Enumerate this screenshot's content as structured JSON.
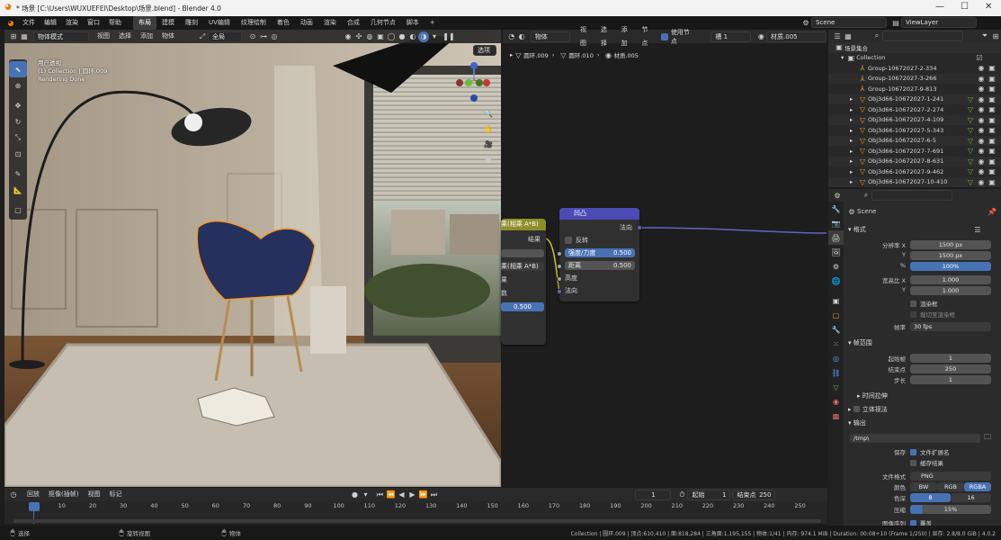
{
  "window": {
    "title": "* 场景 [C:\\Users\\WUXUEFEI\\Desktop\\场景.blend] - Blender 4.0"
  },
  "menus": [
    "文件",
    "编辑",
    "渲染",
    "窗口",
    "帮助"
  ],
  "workspaces": [
    {
      "label": "布局",
      "active": true
    },
    {
      "label": "建模"
    },
    {
      "label": "雕刻"
    },
    {
      "label": "UV编辑"
    },
    {
      "label": "纹理绘制"
    },
    {
      "label": "着色"
    },
    {
      "label": "动画"
    },
    {
      "label": "渲染"
    },
    {
      "label": "合成"
    },
    {
      "label": "几何节点"
    },
    {
      "label": "脚本"
    },
    {
      "label": "+"
    }
  ],
  "scene_selector": {
    "value": "Scene"
  },
  "viewlayer_selector": {
    "value": "ViewLayer"
  },
  "viewport": {
    "mode": "物体模式",
    "menus": [
      "视图",
      "选择",
      "添加",
      "物体"
    ],
    "orientation": "全局",
    "options_label": "选项",
    "overlay_lines": [
      "用户透视",
      "(1) Collection | 圆环.009",
      "Rendering Done"
    ]
  },
  "node_editor": {
    "type": "物体",
    "menus": [
      "视图",
      "选择",
      "添加",
      "节点"
    ],
    "use_nodes_label": "使用节点",
    "slot": "槽 1",
    "material": "材质.005",
    "breadcrumb": [
      "圆环.009",
      "圆环.010",
      "材质.005"
    ],
    "bump_node": {
      "title": "凹凸",
      "output": "法向",
      "invert": "反转",
      "strength_label": "强度/力度",
      "strength": "0.500",
      "distance_label": "距离",
      "distance": "0.500",
      "height": "高度",
      "normal": "法向"
    },
    "partial_node": {
      "title": "乘(相乘 A*B)",
      "output": "结果",
      "dropdown": "乘(相乘 A*B)",
      "label1": "果",
      "label2": "数",
      "value": "0.500"
    }
  },
  "outliner": {
    "search_placeholder": "",
    "root": "场景集合",
    "collection": "Collection",
    "items": [
      {
        "name": "Group-10672027-2-334",
        "kind": "group"
      },
      {
        "name": "Group-10672027-3-266",
        "kind": "group"
      },
      {
        "name": "Group-10672027-9-813",
        "kind": "group"
      },
      {
        "name": "Obj3d66-10672027-1-241",
        "kind": "mesh"
      },
      {
        "name": "Obj3d66-10672027-2-274",
        "kind": "mesh"
      },
      {
        "name": "Obj3d66-10672027-4-109",
        "kind": "mesh"
      },
      {
        "name": "Obj3d66-10672027-5-343",
        "kind": "mesh"
      },
      {
        "name": "Obj3d66-10672027-6-5",
        "kind": "mesh"
      },
      {
        "name": "Obj3d66-10672027-7-691",
        "kind": "mesh"
      },
      {
        "name": "Obj3d66-10672027-8-631",
        "kind": "mesh"
      },
      {
        "name": "Obj3d66-10672027-9-462",
        "kind": "mesh"
      },
      {
        "name": "Obj3d66-10672027-10-410",
        "kind": "mesh"
      }
    ]
  },
  "properties": {
    "scene_name": "Scene",
    "format": {
      "title": "格式",
      "res_x_label": "分辨率 X",
      "res_x": "1500 px",
      "y_label": "Y",
      "res_y": "1500 px",
      "pct_label": "%",
      "pct": "100%",
      "aspect_x_label": "宽高比 X",
      "aspect_x": "1.000",
      "aspect_y_label": "Y",
      "aspect_y": "1.000",
      "render_region": "渲染框",
      "crop": "裁切至渲染框",
      "fps_label": "帧率",
      "fps": "30 fps"
    },
    "frame_range": {
      "title": "帧范围",
      "start_label": "起始帧",
      "start": "1",
      "end_label": "结束点",
      "end": "250",
      "step_label": "步长",
      "step": "1"
    },
    "time_stretch": "时间拉伸",
    "stereo": "立体视法",
    "output": {
      "title": "输出",
      "path": "/tmp\\",
      "save_label": "保存",
      "file_ext": "文件扩展名",
      "cache": "缓存结果",
      "format_label": "文件格式",
      "format": "PNG",
      "color_label": "颜色",
      "bw": "BW",
      "rgb": "RGB",
      "rgba": "RGBA",
      "depth_label": "色深",
      "depth8": "8",
      "depth16": "16",
      "compress_label": "压缩",
      "compress": "15%",
      "overwrite_label": "图像序列",
      "overwrite": "覆盖"
    }
  },
  "timeline": {
    "menus": [
      "回放",
      "抠像(插帧)",
      "视图",
      "标记"
    ],
    "current_frame": "1",
    "start_label": "起始",
    "start": "1",
    "end_label": "结束点",
    "end": "250",
    "ticks": [
      "1",
      "10",
      "20",
      "30",
      "40",
      "50",
      "60",
      "70",
      "80",
      "90",
      "100",
      "110",
      "120",
      "130",
      "140",
      "150",
      "160",
      "170",
      "180",
      "190",
      "200",
      "210",
      "220",
      "230",
      "240",
      "250"
    ]
  },
  "statusbar": {
    "left": [
      "选择",
      "旋转视图",
      "物体"
    ],
    "right": "Collection | 圆环.009 | 顶点:610,410 | 面:818,284 | 三角面:1,195,155 | 物体:1/41 | 内存: 974.1 MiB | Duration: 00:08+10 (Frame 1/250) | 显存: 2.8/8.0 GiB | 4.0.2"
  },
  "colors": {
    "accent": "#4772b3",
    "active_orange": "#f39c2e",
    "node_vector": "#5b5bb5",
    "node_converter": "#9b9b2e"
  }
}
